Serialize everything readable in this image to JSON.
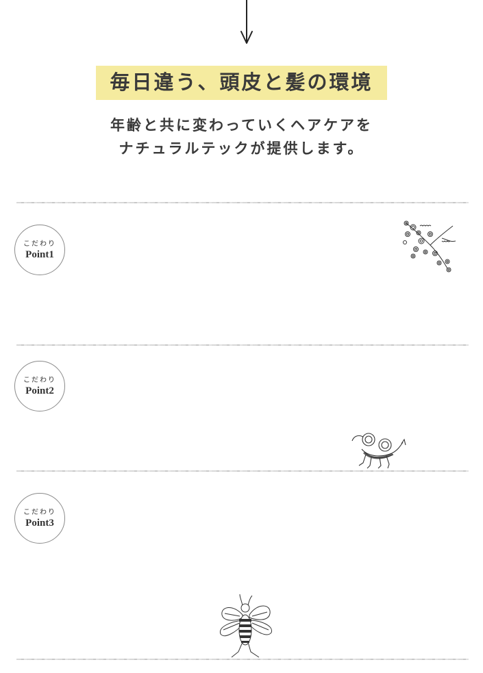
{
  "intro": {
    "headline": "毎日違う、頭皮と髪の環境",
    "subline1": "年齢と共に変わっていくヘアケアを",
    "subline2": "ナチュラルテックが提供します。",
    "highlight_color": "#f5eb9f"
  },
  "points": [
    {
      "kodawari": "こだわり",
      "label": "Point1",
      "illustration": "swirl-vine-illustration"
    },
    {
      "kodawari": "こだわり",
      "label": "Point2",
      "illustration": "bug-creature-illustration"
    },
    {
      "kodawari": "こだわり",
      "label": "Point3",
      "illustration": "bee-illustration"
    }
  ]
}
